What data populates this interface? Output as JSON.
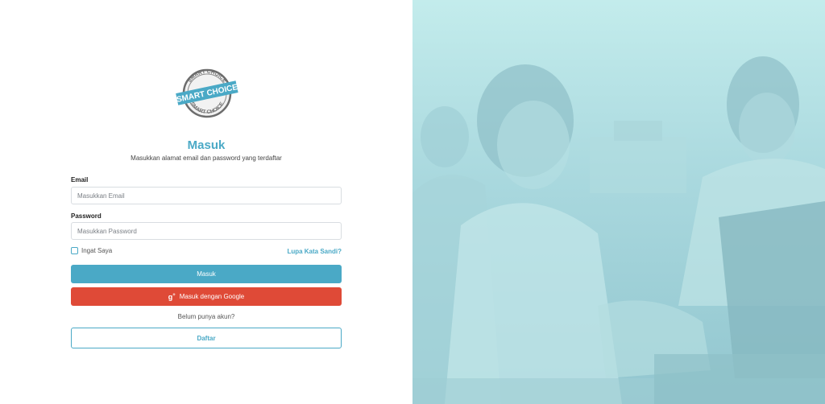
{
  "logo": {
    "text_top": "SMART CHOICE",
    "text_banner": "SMART CHOICE",
    "text_bottom": "SMART CHOICE"
  },
  "form": {
    "title": "Masuk",
    "subtitle": "Masukkan alamat email dan password yang terdaftar",
    "email_label": "Email",
    "email_placeholder": "Masukkan Email",
    "password_label": "Password",
    "password_placeholder": "Masukkan Password",
    "remember_label": "Ingat Saya",
    "forgot_link": "Lupa Kata Sandi?",
    "login_button": "Masuk",
    "google_button": "Masuk dengan Google",
    "no_account_text": "Belum punya akun?",
    "register_button": "Daftar"
  },
  "colors": {
    "accent": "#4aa9c6",
    "google": "#df4a37"
  },
  "icons": {
    "google": "google-plus-icon"
  }
}
